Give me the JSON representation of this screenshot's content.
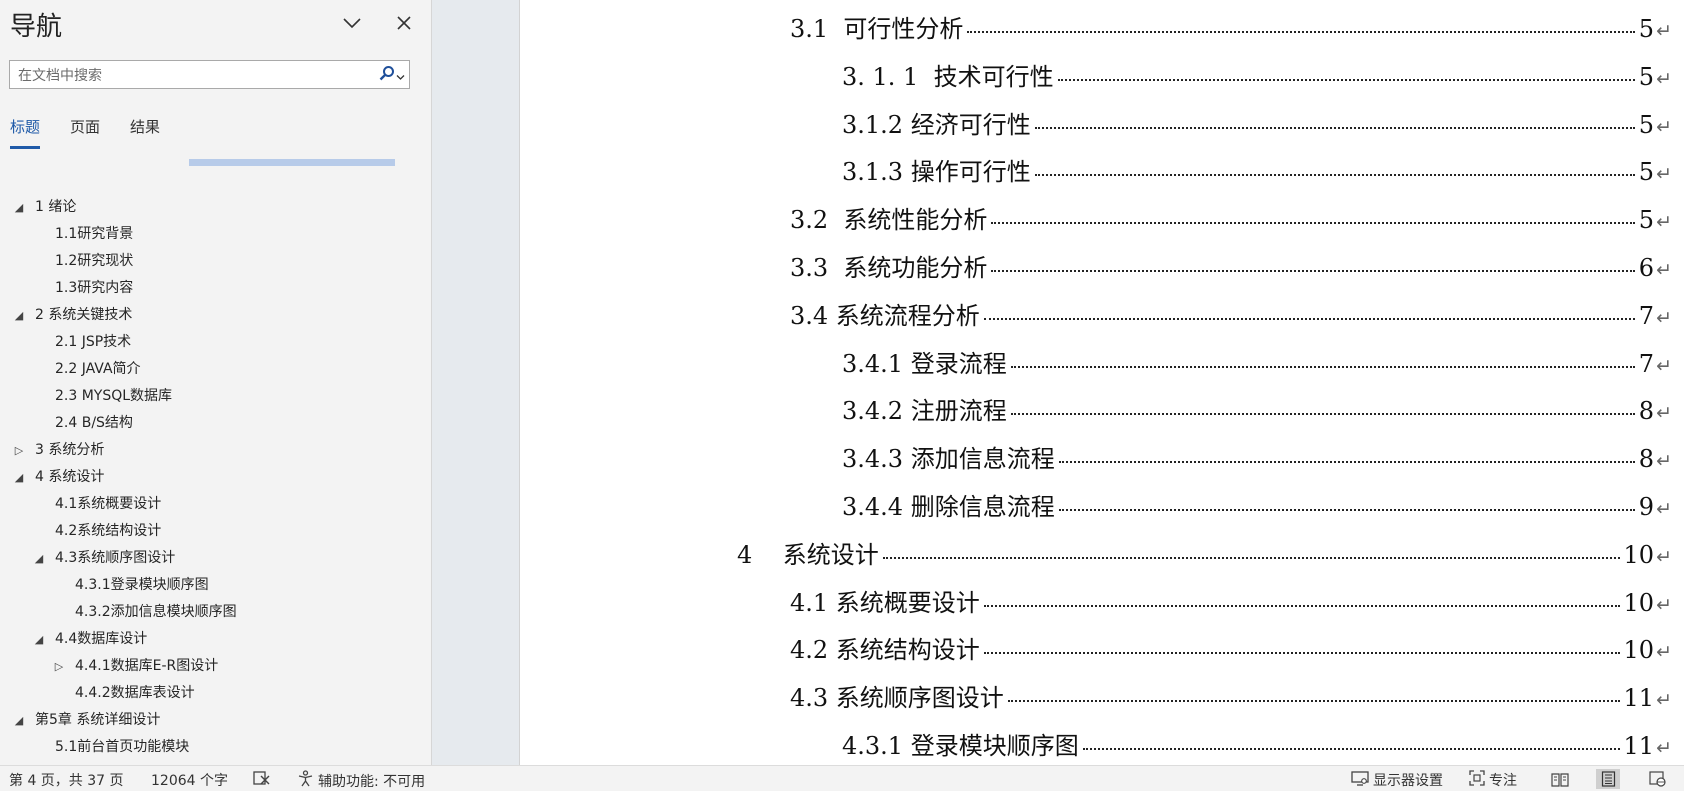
{
  "nav": {
    "title": "导航",
    "search_placeholder": "在文档中搜索",
    "tabs": [
      {
        "label": "标题",
        "active": true
      },
      {
        "label": "页面",
        "active": false
      },
      {
        "label": "结果",
        "active": false
      }
    ],
    "headings": [
      {
        "label": "1 绪论",
        "level": 0,
        "state": "expanded"
      },
      {
        "label": "1.1研究背景",
        "level": 1,
        "state": "leaf"
      },
      {
        "label": "1.2研究现状",
        "level": 1,
        "state": "leaf"
      },
      {
        "label": "1.3研究内容",
        "level": 1,
        "state": "leaf"
      },
      {
        "label": "2 系统关键技术",
        "level": 0,
        "state": "expanded"
      },
      {
        "label": "2.1 JSP技术",
        "level": 1,
        "state": "leaf"
      },
      {
        "label": "2.2 JAVA简介",
        "level": 1,
        "state": "leaf"
      },
      {
        "label": "2.3 MYSQL数据库",
        "level": 1,
        "state": "leaf"
      },
      {
        "label": "2.4 B/S结构",
        "level": 1,
        "state": "leaf"
      },
      {
        "label": "3 系统分析",
        "level": 0,
        "state": "collapsed"
      },
      {
        "label": "4 系统设计",
        "level": 0,
        "state": "expanded"
      },
      {
        "label": "4.1系统概要设计",
        "level": 1,
        "state": "leaf"
      },
      {
        "label": "4.2系统结构设计",
        "level": 1,
        "state": "leaf"
      },
      {
        "label": "4.3系统顺序图设计",
        "level": 1,
        "state": "expanded"
      },
      {
        "label": "4.3.1登录模块顺序图",
        "level": 2,
        "state": "leaf"
      },
      {
        "label": "4.3.2添加信息模块顺序图",
        "level": 2,
        "state": "leaf"
      },
      {
        "label": "4.4数据库设计",
        "level": 1,
        "state": "expanded"
      },
      {
        "label": "4.4.1数据库E-R图设计",
        "level": 2,
        "state": "collapsed"
      },
      {
        "label": "4.4.2数据库表设计",
        "level": 2,
        "state": "leaf"
      },
      {
        "label": "第5章 系统详细设计",
        "level": 0,
        "state": "expanded"
      },
      {
        "label": "5.1前台首页功能模块",
        "level": 1,
        "state": "leaf"
      }
    ]
  },
  "toc": [
    {
      "text": "3.1  可行性分析",
      "page": "5",
      "level": 1
    },
    {
      "text": "3. 1. 1  技术可行性",
      "page": "5",
      "level": 2
    },
    {
      "text": "3.1.2 经济可行性",
      "page": "5",
      "level": 2
    },
    {
      "text": "3.1.3 操作可行性",
      "page": "5",
      "level": 2
    },
    {
      "text": "3.2  系统性能分析",
      "page": "5",
      "level": 1
    },
    {
      "text": "3.3  系统功能分析",
      "page": "6",
      "level": 1
    },
    {
      "text": "3.4 系统流程分析",
      "page": "7",
      "level": 1
    },
    {
      "text": "3.4.1 登录流程",
      "page": "7",
      "level": 2
    },
    {
      "text": "3.4.2 注册流程",
      "page": "8",
      "level": 2
    },
    {
      "text": "3.4.3 添加信息流程",
      "page": "8",
      "level": 2
    },
    {
      "text": "3.4.4 删除信息流程",
      "page": "9",
      "level": 2
    },
    {
      "text": "4    系统设计",
      "page": "10",
      "level": 0
    },
    {
      "text": "4.1 系统概要设计",
      "page": "10",
      "level": 1
    },
    {
      "text": "4.2 系统结构设计",
      "page": "10",
      "level": 1
    },
    {
      "text": "4.3 系统顺序图设计",
      "page": "11",
      "level": 1
    },
    {
      "text": "4.3.1 登录模块顺序图",
      "page": "11",
      "level": 2
    }
  ],
  "paragraph_mark": "↵",
  "status": {
    "page_info": "第 4 页，共 37 页",
    "word_count": "12064 个字",
    "accessibility": "辅助功能: 不可用",
    "display_settings": "显示器设置",
    "focus": "专注"
  },
  "colors": {
    "accent": "#1f5aa8",
    "pane_bg": "#f3f3f3",
    "gutter_bg": "#e6eaee"
  }
}
